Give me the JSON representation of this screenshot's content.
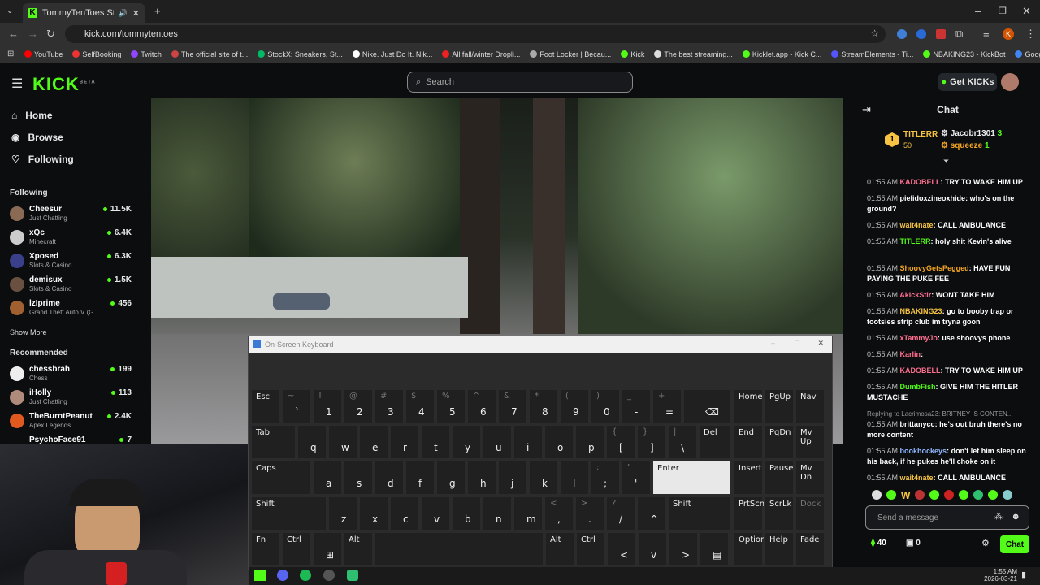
{
  "browser": {
    "tab_title": "TommyTenToes Stream - W",
    "url": "kick.com/tommytentoes",
    "profile_initial": "K",
    "bookmarks": [
      "YouTube",
      "SelfBooking",
      "Twitch",
      "The official site of t...",
      "StockX: Sneakers, St...",
      "Nike. Just Do It. Nik...",
      "All fall/winter Dropli...",
      "Foot Locker | Becau...",
      "Kick",
      "The best streaming...",
      "Kicklet.app - Kick C...",
      "StreamElements - Ti...",
      "NBAKING23 - KickBot",
      "Google"
    ]
  },
  "kick": {
    "logo": "KICK",
    "beta": "BETA",
    "search_placeholder": "Search",
    "get_kicks": "Get KICKs"
  },
  "sidebar": {
    "nav": [
      {
        "label": "Home",
        "icon": "home-icon"
      },
      {
        "label": "Browse",
        "icon": "compass-icon"
      },
      {
        "label": "Following",
        "icon": "heart-icon"
      }
    ],
    "following_title": "Following",
    "following": [
      {
        "name": "Cheesur",
        "category": "Just Chatting",
        "viewers": "11.5K"
      },
      {
        "name": "xQc",
        "category": "Minecraft",
        "viewers": "6.4K"
      },
      {
        "name": "Xposed",
        "category": "Slots & Casino",
        "viewers": "6.3K"
      },
      {
        "name": "demisux",
        "category": "Slots & Casino",
        "viewers": "1.5K"
      },
      {
        "name": "lzIprime",
        "category": "Grand Theft Auto V (G...",
        "viewers": "456"
      }
    ],
    "show_more": "Show More",
    "recommended_title": "Recommended",
    "recommended": [
      {
        "name": "chessbrah",
        "category": "Chess",
        "viewers": "199"
      },
      {
        "name": "iHolly",
        "category": "Just Chatting",
        "viewers": "113"
      },
      {
        "name": "TheBurntPeanut",
        "category": "Apex Legends",
        "viewers": "2.4K"
      },
      {
        "name": "PsychoFace91",
        "category": "",
        "viewers": "7"
      }
    ]
  },
  "chat": {
    "title": "Chat",
    "top_gifters": [
      {
        "rank": "1",
        "name": "TITLERR",
        "amount": "50"
      },
      {
        "name": "Jacobr1301",
        "amount": "3"
      },
      {
        "name": "squeeze",
        "amount": "1"
      }
    ],
    "messages": [
      {
        "time": "01:55 AM",
        "user": "KADOBELL",
        "color": "#ff6f91",
        "text": "TRY TO WAKE HIM UP"
      },
      {
        "time": "01:55 AM",
        "user": "pielidoxzineoxhide",
        "color": "#ffffff",
        "text": "who's on the ground?"
      },
      {
        "time": "01:55 AM",
        "user": "wait4nate",
        "color": "#f6c343",
        "text": "CALL AMBULANCE"
      },
      {
        "time": "01:55 AM",
        "user": "TITLERR",
        "color": "#53fc18",
        "text": "holy shit Kevin's alive"
      },
      {
        "time": "01:55 AM",
        "user": "ShoovyGetsPegged",
        "color": "#f6a623",
        "text": "HAVE FUN PAYING THE PUKE FEE"
      },
      {
        "time": "01:55 AM",
        "user": "AkickStir",
        "color": "#ff6f91",
        "text": "WONT TAKE HIM"
      },
      {
        "time": "01:55 AM",
        "user": "NBAKING23",
        "color": "#f6c343",
        "text": "go to booby trap or tootsies strip club im tryna goon"
      },
      {
        "time": "01:55 AM",
        "user": "xTammyJo",
        "color": "#ff6f91",
        "text": "use shoovys phone"
      },
      {
        "time": "01:55 AM",
        "user": "Karlin",
        "color": "#ff6f91",
        "text": ""
      },
      {
        "time": "01:55 AM",
        "user": "KADOBELL",
        "color": "#ff6f91",
        "text": "TRY TO WAKE HIM UP"
      },
      {
        "time": "01:55 AM",
        "user": "DumbFish",
        "color": "#53fc18",
        "text": "GIVE HIM THE HITLER MUSTACHE"
      },
      {
        "time": "01:55 AM",
        "user": "brittanycc",
        "color": "#ffffff",
        "text": "he's out bruh there's no more content",
        "reply": "Replying to Lacrimosa23: BRITNEY IS CONTEN..."
      },
      {
        "time": "01:55 AM",
        "user": "bookhockeys",
        "color": "#8fb4ff",
        "text": "don't let him sleep on his back, if he pukes he'll choke on it"
      },
      {
        "time": "01:55 AM",
        "user": "wait4nate",
        "color": "#f6c343",
        "text": "CALL AMBULANCE"
      }
    ],
    "send_placeholder": "Send a message",
    "kicks_count": "40",
    "gift_count": "0",
    "chat_button": "Chat"
  },
  "osk": {
    "title": "On-Screen Keyboard",
    "row1": [
      {
        "p": "Esc",
        "s": ""
      },
      {
        "p": "`",
        "s": "~"
      },
      {
        "p": "1",
        "s": "!"
      },
      {
        "p": "2",
        "s": "@"
      },
      {
        "p": "3",
        "s": "#"
      },
      {
        "p": "4",
        "s": "$"
      },
      {
        "p": "5",
        "s": "%"
      },
      {
        "p": "6",
        "s": "^"
      },
      {
        "p": "7",
        "s": "&"
      },
      {
        "p": "8",
        "s": "*"
      },
      {
        "p": "9",
        "s": "("
      },
      {
        "p": "0",
        "s": ")"
      },
      {
        "p": "-",
        "s": "_"
      },
      {
        "p": "=",
        "s": "+"
      },
      {
        "p": "⌫",
        "s": ""
      }
    ],
    "row2": [
      {
        "p": "Tab",
        "s": ""
      },
      {
        "p": "q",
        "s": ""
      },
      {
        "p": "w",
        "s": ""
      },
      {
        "p": "e",
        "s": ""
      },
      {
        "p": "r",
        "s": ""
      },
      {
        "p": "t",
        "s": ""
      },
      {
        "p": "y",
        "s": ""
      },
      {
        "p": "u",
        "s": ""
      },
      {
        "p": "i",
        "s": ""
      },
      {
        "p": "o",
        "s": ""
      },
      {
        "p": "p",
        "s": ""
      },
      {
        "p": "[",
        "s": "{"
      },
      {
        "p": "]",
        "s": "}"
      },
      {
        "p": "\\",
        "s": "|"
      },
      {
        "p": "Del",
        "s": ""
      }
    ],
    "row3": [
      {
        "p": "Caps",
        "s": ""
      },
      {
        "p": "a",
        "s": ""
      },
      {
        "p": "s",
        "s": ""
      },
      {
        "p": "d",
        "s": ""
      },
      {
        "p": "f",
        "s": ""
      },
      {
        "p": "g",
        "s": ""
      },
      {
        "p": "h",
        "s": ""
      },
      {
        "p": "j",
        "s": ""
      },
      {
        "p": "k",
        "s": ""
      },
      {
        "p": "l",
        "s": ""
      },
      {
        "p": ";",
        "s": ":"
      },
      {
        "p": "'",
        "s": "\""
      },
      {
        "p": "Enter",
        "s": ""
      }
    ],
    "row4": [
      {
        "p": "Shift",
        "s": ""
      },
      {
        "p": "z",
        "s": ""
      },
      {
        "p": "x",
        "s": ""
      },
      {
        "p": "c",
        "s": ""
      },
      {
        "p": "v",
        "s": ""
      },
      {
        "p": "b",
        "s": ""
      },
      {
        "p": "n",
        "s": ""
      },
      {
        "p": "m",
        "s": ""
      },
      {
        "p": ",",
        "s": "<"
      },
      {
        "p": ".",
        "s": ">"
      },
      {
        "p": "/",
        "s": "?"
      },
      {
        "p": "^",
        "s": ""
      },
      {
        "p": "Shift",
        "s": ""
      }
    ],
    "row5": [
      {
        "p": "Fn",
        "s": ""
      },
      {
        "p": "Ctrl",
        "s": ""
      },
      {
        "p": "⊞",
        "s": ""
      },
      {
        "p": "Alt",
        "s": ""
      },
      {
        "p": "",
        "s": ""
      },
      {
        "p": "Alt",
        "s": ""
      },
      {
        "p": "Ctrl",
        "s": ""
      },
      {
        "p": "<",
        "s": ""
      },
      {
        "p": "v",
        "s": ""
      },
      {
        "p": ">",
        "s": ""
      },
      {
        "p": "▤",
        "s": ""
      }
    ],
    "nav_keys": [
      [
        "Home",
        "PgUp",
        "Nav"
      ],
      [
        "End",
        "PgDn",
        "Mv Up"
      ],
      [
        "Insert",
        "Pause",
        "Mv Dn"
      ],
      [
        "PrtScn",
        "ScrLk",
        "Dock"
      ],
      [
        "Options",
        "Help",
        "Fade"
      ]
    ]
  },
  "taskbar": {
    "time": "1:55 AM",
    "date": "2026-03-21"
  }
}
